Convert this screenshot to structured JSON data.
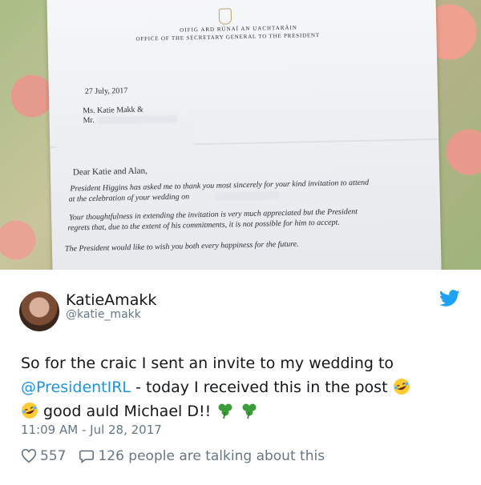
{
  "letter": {
    "header_line1": "Oifig Ard Rúnaí an Uachtaráin",
    "header_line2": "Office of the Secretary General to the President",
    "date": "27 July, 2017",
    "recipient": "Ms. Katie Makk &",
    "recipient2": "Mr.",
    "salutation": "Dear Katie and Alan,",
    "para1_line1": "President Higgins has asked me to thank you most sincerely for your kind invitation to attend",
    "para1_line2": "at the celebration of your wedding on",
    "para2_line1": "Your thoughtfulness in extending the invitation is very much appreciated but the President",
    "para2_line2": "regrets that, due to the extent of his commitments, it is not possible for him to accept.",
    "para3": "The President would like to wish you both every happiness for the future."
  },
  "tweet": {
    "display_name": "KatieAmakk",
    "handle": "@katie_makk",
    "text_before": "So for the craic I sent an invite to my wedding to",
    "mention": "@PresidentIRL",
    "text_after": " - today I received this in the post",
    "text_line3": "good auld Michael D!!",
    "timestamp": "11:09 AM - Jul 28, 2017",
    "likes": "557",
    "replies": "126 people are talking about this"
  },
  "icons": {
    "brand": "twitter-bird-icon",
    "like": "heart-outline-icon",
    "reply": "speech-bubble-icon",
    "emoji1": "rolling-on-floor-laughing-emoji",
    "emoji2": "shamrock-emoji"
  },
  "colors": {
    "twitter_blue": "#1da1f2",
    "mention": "#1b95e0",
    "secondary_text": "#657786",
    "primary_text": "#14171a",
    "shamrock": "#3a9d3a"
  }
}
